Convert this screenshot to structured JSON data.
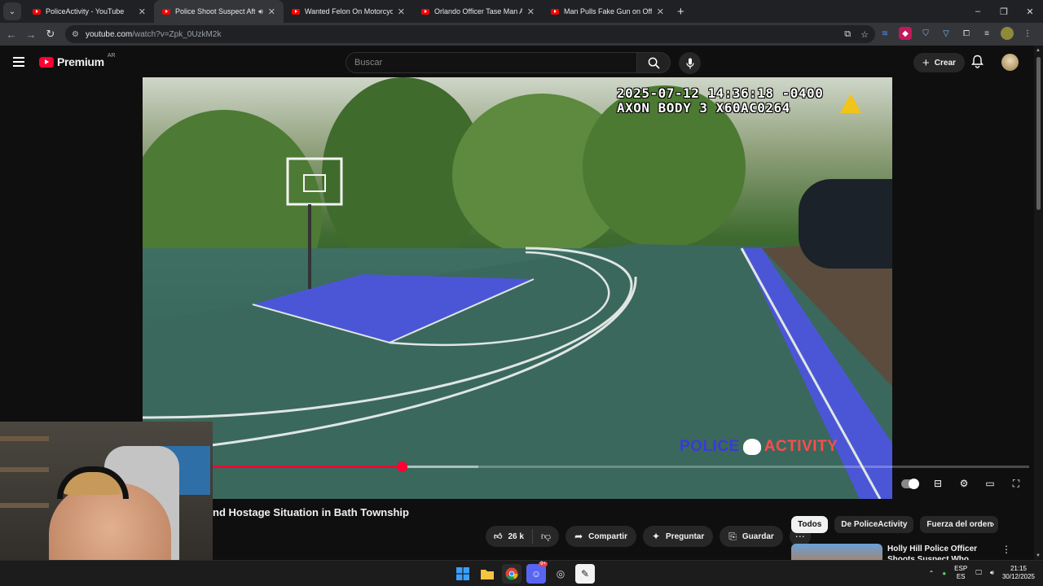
{
  "browser": {
    "tabs": [
      {
        "title": "PoliceActivity - YouTube",
        "active": false,
        "audio": false
      },
      {
        "title": "Police Shoot Suspect After",
        "active": true,
        "audio": true
      },
      {
        "title": "Wanted Felon On Motorcycle L",
        "active": false,
        "audio": false
      },
      {
        "title": "Orlando Officer Tase Man Arme",
        "active": false,
        "audio": false
      },
      {
        "title": "Man Pulls Fake Gun on Officers",
        "active": false,
        "audio": false
      }
    ],
    "new_tab_symbol": "+",
    "url_host": "youtube.com",
    "url_path": "/watch?v=Zpk_0UzkM2k",
    "window_controls": [
      "–",
      "❐",
      "✕"
    ]
  },
  "youtube": {
    "brand": "Premium",
    "region": "AR",
    "search_placeholder": "Buscar",
    "create_label": "Crear"
  },
  "video": {
    "timestamp_line1": "2025-07-12 14:36:18 -0400",
    "timestamp_line2": "AXON BODY 3 X60AC0264",
    "watermark_left": "POLICE",
    "watermark_right": "ACTIVITY",
    "progress_played": 0.292,
    "progress_buffered": 0.379,
    "accent_color": "#ff0033"
  },
  "watch": {
    "title": "nd Hostage Situation in Bath Township",
    "likes": "26 k",
    "share_label": "Compartir",
    "ask_label": "Preguntar",
    "save_label": "Guardar"
  },
  "related": {
    "chips": [
      "Todos",
      "De PoliceActivity",
      "Fuerza del orden"
    ],
    "items": [
      {
        "title": "Holly Hill Police Officer Shoots Suspect Who Charged at Him"
      }
    ]
  },
  "taskbar": {
    "lang_top": "ESP",
    "lang_bottom": "ES",
    "time": "21:15",
    "date": "30/12/2025",
    "chat_badge": "9+"
  }
}
